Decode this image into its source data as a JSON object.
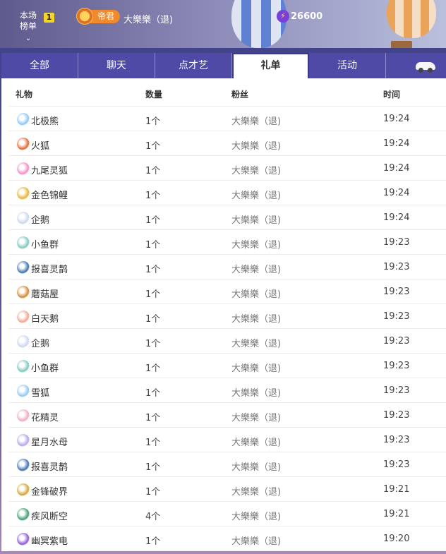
{
  "header": {
    "rank_label_line1": "本场",
    "rank_label_line2": "榜单",
    "rank_chevron": "chevron-down-icon",
    "rank_number": "1",
    "badge_label": "帝君",
    "badge_icon": "crown-badge-icon",
    "user_name": "大樂樂（退)",
    "coin_icon": "lightning-coin-icon",
    "coin_value": "26600"
  },
  "tabs": [
    {
      "label": "全部",
      "active": false
    },
    {
      "label": "聊天",
      "active": false
    },
    {
      "label": "点才艺",
      "active": false
    },
    {
      "label": "礼单",
      "active": true
    },
    {
      "label": "活动",
      "active": false
    },
    {
      "label": "",
      "icon": "car-icon",
      "active": false
    }
  ],
  "table": {
    "headers": {
      "gift": "礼物",
      "qty": "数量",
      "fan": "粉丝",
      "time": "时间"
    },
    "rows": [
      {
        "icon": "polar-bear-icon",
        "color": "#8fc6ee",
        "gift": "北极熊",
        "qty": "1个",
        "fan": "大樂樂（退)",
        "time": "19:24"
      },
      {
        "icon": "fire-fox-icon",
        "color": "#e0662e",
        "gift": "火狐",
        "qty": "1个",
        "fan": "大樂樂（退)",
        "time": "19:24"
      },
      {
        "icon": "nine-tail-fox-icon",
        "color": "#f08cc0",
        "gift": "九尾灵狐",
        "qty": "1个",
        "fan": "大樂樂（退)",
        "time": "19:24"
      },
      {
        "icon": "golden-koi-icon",
        "color": "#e6b12e",
        "gift": "金色锦鲤",
        "qty": "1个",
        "fan": "大樂樂（退)",
        "time": "19:24"
      },
      {
        "icon": "penguin-icon",
        "color": "#c9d6ee",
        "gift": "企鹅",
        "qty": "1个",
        "fan": "大樂樂（退)",
        "time": "19:24"
      },
      {
        "icon": "fish-school-icon",
        "color": "#7cc6c0",
        "gift": "小鱼群",
        "qty": "1个",
        "fan": "大樂樂（退)",
        "time": "19:23"
      },
      {
        "icon": "magpie-icon",
        "color": "#3d6fae",
        "gift": "报喜灵鹊",
        "qty": "1个",
        "fan": "大樂樂（退)",
        "time": "19:23"
      },
      {
        "icon": "mushroom-house-icon",
        "color": "#d2862f",
        "gift": "蘑菇屋",
        "qty": "1个",
        "fan": "大樂樂（退)",
        "time": "19:23"
      },
      {
        "icon": "white-swan-icon",
        "color": "#f2a48c",
        "gift": "白天鹅",
        "qty": "1个",
        "fan": "大樂樂（退)",
        "time": "19:23"
      },
      {
        "icon": "penguin-icon",
        "color": "#c9d6ee",
        "gift": "企鹅",
        "qty": "1个",
        "fan": "大樂樂（退)",
        "time": "19:23"
      },
      {
        "icon": "fish-school-icon",
        "color": "#7cc6c0",
        "gift": "小鱼群",
        "qty": "1个",
        "fan": "大樂樂（退)",
        "time": "19:23"
      },
      {
        "icon": "snow-fox-icon",
        "color": "#8ec9ee",
        "gift": "雪狐",
        "qty": "1个",
        "fan": "大樂樂（退)",
        "time": "19:23"
      },
      {
        "icon": "flower-sprite-icon",
        "color": "#f3a7c7",
        "gift": "花精灵",
        "qty": "1个",
        "fan": "大樂樂（退)",
        "time": "19:23"
      },
      {
        "icon": "jellyfish-icon",
        "color": "#b8a2ea",
        "gift": "星月水母",
        "qty": "1个",
        "fan": "大樂樂（退)",
        "time": "19:23"
      },
      {
        "icon": "magpie-icon",
        "color": "#3d6fae",
        "gift": "报喜灵鹊",
        "qty": "1个",
        "fan": "大樂樂（退)",
        "time": "19:23"
      },
      {
        "icon": "golden-blade-icon",
        "color": "#d6a12c",
        "gift": "金锋破界",
        "qty": "1个",
        "fan": "大樂樂（退)",
        "time": "19:21"
      },
      {
        "icon": "wind-blade-icon",
        "color": "#3f9a6e",
        "gift": "疾风断空",
        "qty": "4个",
        "fan": "大樂樂（退)",
        "time": "19:21"
      },
      {
        "icon": "purple-lightning-icon",
        "color": "#8a55d6",
        "gift": "幽冥紫电",
        "qty": "1个",
        "fan": "大樂樂（退)",
        "time": "19:20"
      }
    ]
  }
}
